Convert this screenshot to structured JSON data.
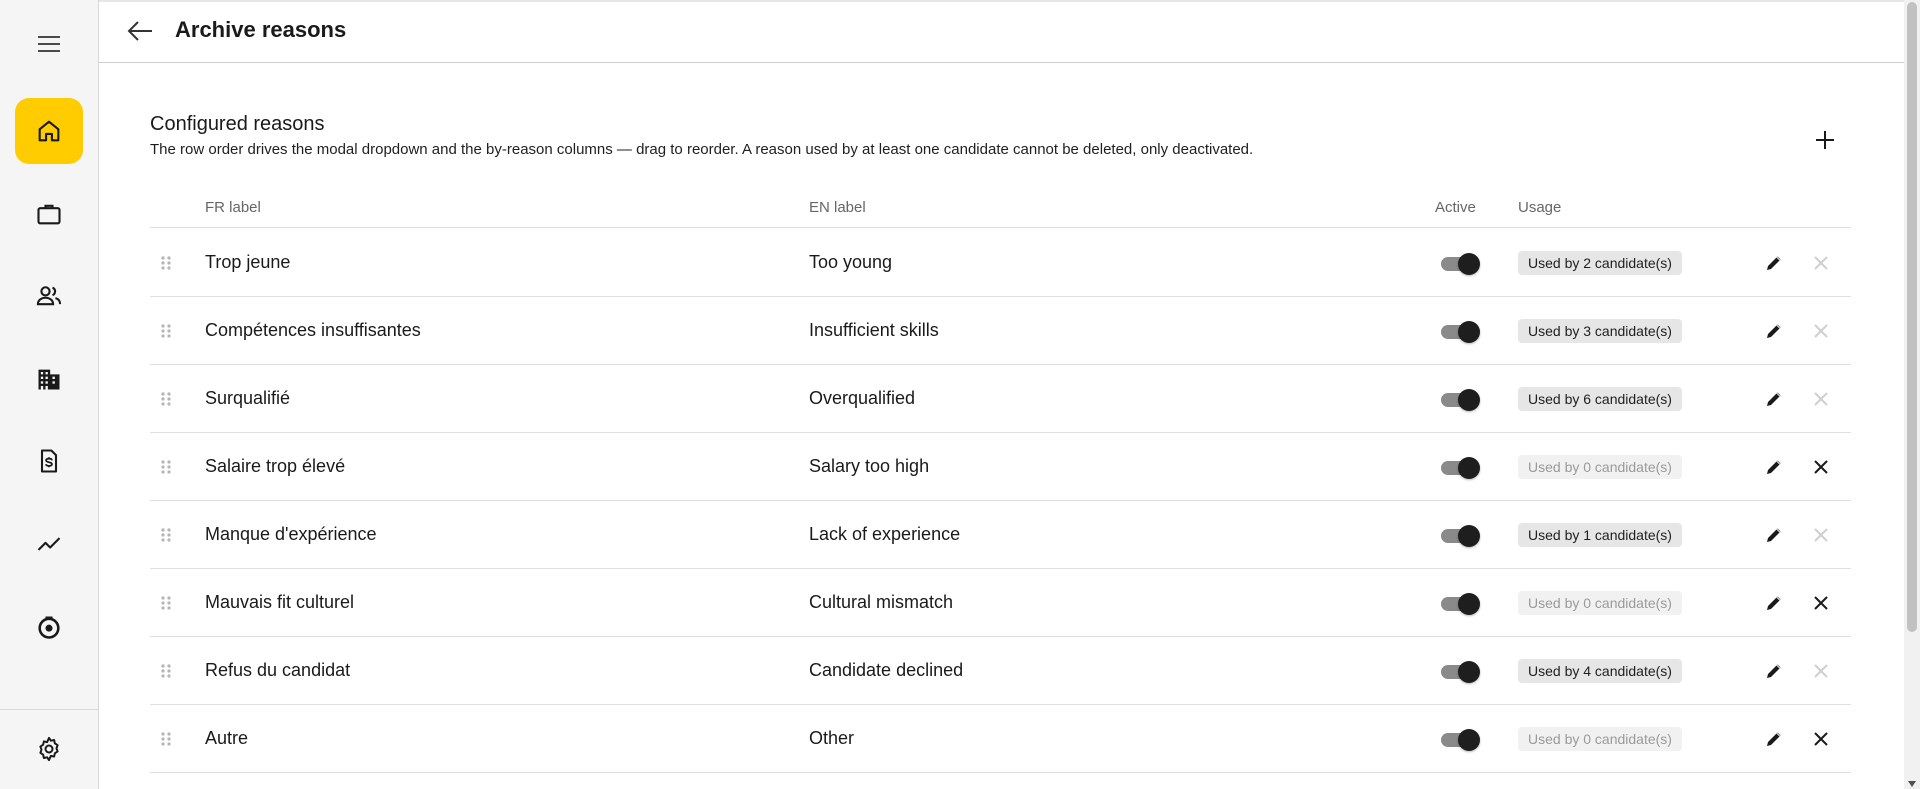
{
  "header": {
    "title": "Archive reasons"
  },
  "section": {
    "title": "Configured reasons",
    "description": "The row order drives the modal dropdown and the by-reason columns — drag to reorder. A reason used by at least one candidate cannot be deleted, only deactivated."
  },
  "table": {
    "headers": {
      "fr": "FR label",
      "en": "EN label",
      "active": "Active",
      "usage": "Usage"
    },
    "rows": [
      {
        "fr": "Trop jeune",
        "en": "Too young",
        "active": true,
        "usage": "Used by 2 candidate(s)",
        "deletable": false
      },
      {
        "fr": "Compétences insuffisantes",
        "en": "Insufficient skills",
        "active": true,
        "usage": "Used by 3 candidate(s)",
        "deletable": false
      },
      {
        "fr": "Surqualifié",
        "en": "Overqualified",
        "active": true,
        "usage": "Used by 6 candidate(s)",
        "deletable": false
      },
      {
        "fr": "Salaire trop élevé",
        "en": "Salary too high",
        "active": true,
        "usage": "Used by 0 candidate(s)",
        "deletable": true
      },
      {
        "fr": "Manque d'expérience",
        "en": "Lack of experience",
        "active": true,
        "usage": "Used by 1 candidate(s)",
        "deletable": false
      },
      {
        "fr": "Mauvais fit culturel",
        "en": "Cultural mismatch",
        "active": true,
        "usage": "Used by 0 candidate(s)",
        "deletable": true
      },
      {
        "fr": "Refus du candidat",
        "en": "Candidate declined",
        "active": true,
        "usage": "Used by 4 candidate(s)",
        "deletable": false
      },
      {
        "fr": "Autre",
        "en": "Other",
        "active": true,
        "usage": "Used by 0 candidate(s)",
        "deletable": true
      }
    ]
  },
  "sidebar": {
    "items": [
      {
        "icon": "home-icon",
        "active": true
      },
      {
        "icon": "briefcase-icon",
        "active": false
      },
      {
        "icon": "people-icon",
        "active": false
      },
      {
        "icon": "building-icon",
        "active": false
      },
      {
        "icon": "invoice-icon",
        "active": false
      },
      {
        "icon": "chart-line-icon",
        "active": false
      },
      {
        "icon": "settings-gear-alt-icon",
        "active": false
      }
    ],
    "bottom_icon": "settings-icon"
  },
  "colors": {
    "accent": "#ffcc00",
    "toggle_knob": "#1e1e1e",
    "toggle_track": "#8a8a8a",
    "badge_bg": "#e6e6e6",
    "badge_unused_text": "#9a9a9a"
  }
}
